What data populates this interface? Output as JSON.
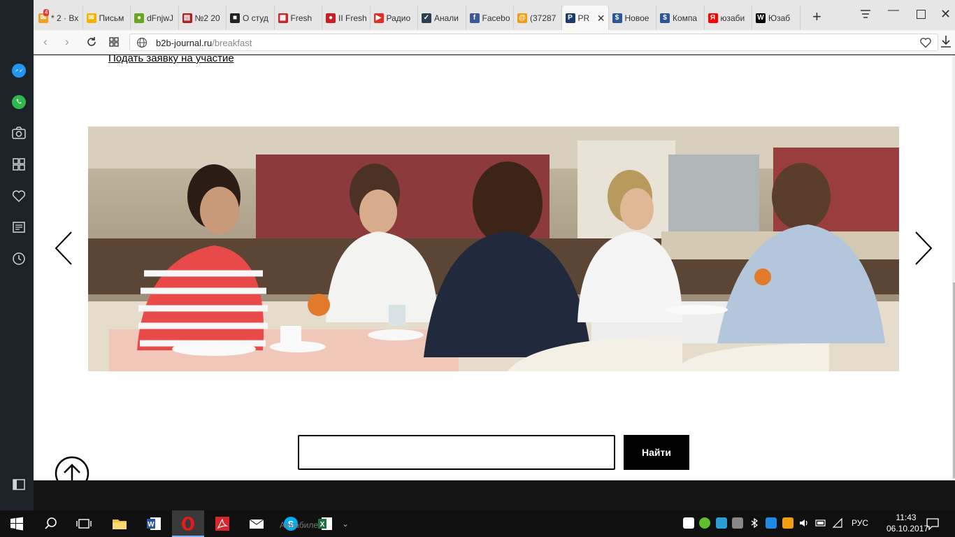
{
  "browser": {
    "tabs": [
      {
        "title": "* 2 · Вх",
        "icon": "mail-icon",
        "color": "#f0a020",
        "badge": "4"
      },
      {
        "title": "Письм",
        "icon": "envelope-icon",
        "color": "#f4b400"
      },
      {
        "title": "dFnjwJ",
        "icon": "green-circle-icon",
        "color": "#6aa51f"
      },
      {
        "title": "№2 20",
        "icon": "stripes-icon",
        "color": "#b02020"
      },
      {
        "title": "О студ",
        "icon": "square-icon",
        "color": "#222222"
      },
      {
        "title": "Fresh",
        "icon": "grid-icon",
        "color": "#c4272c"
      },
      {
        "title": "II Fresh",
        "icon": "red-circle-icon",
        "color": "#c81f26"
      },
      {
        "title": "Радио",
        "icon": "play-icon",
        "color": "#e52d27"
      },
      {
        "title": "Анали",
        "icon": "check-icon",
        "color": "#2c3e50"
      },
      {
        "title": "Facebo",
        "icon": "facebook-icon",
        "color": "#3b5998"
      },
      {
        "title": "(37287",
        "icon": "at-icon",
        "color": "#f39c12"
      },
      {
        "title": "PR",
        "icon": "pr-icon",
        "color": "#1b3d6e",
        "active": true
      },
      {
        "title": "Новое",
        "icon": "dollar-icon",
        "color": "#2b5797"
      },
      {
        "title": "Компа",
        "icon": "dollar-icon",
        "color": "#2b5797"
      },
      {
        "title": "юзаби",
        "icon": "yandex-icon",
        "color": "#ff0000"
      },
      {
        "title": "Юзаб",
        "icon": "wikipedia-icon",
        "color": "#000000"
      }
    ],
    "url_domain": "b2b-journal.ru",
    "url_path": "/breakfast"
  },
  "page": {
    "apply_link": "Подать заявку на участие",
    "search": {
      "value": "",
      "placeholder": "",
      "button": "Найти"
    }
  },
  "taskbar": {
    "lang": "РУС",
    "time": "11:43",
    "date": "06.10.2017",
    "ghost_text": "Авиабилеты"
  }
}
